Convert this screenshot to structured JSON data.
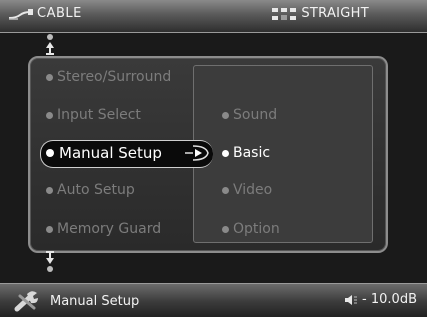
{
  "header": {
    "source": "CABLE",
    "mode": "STRAIGHT",
    "source_icon": "cable-icon",
    "mode_icon": "surround-mode-icon"
  },
  "menu": {
    "items": [
      {
        "label": "Stereo/Surround"
      },
      {
        "label": "Input Select"
      },
      {
        "label": "Manual Setup"
      },
      {
        "label": "Auto Setup"
      },
      {
        "label": "Memory Guard"
      }
    ],
    "selected_index": 2
  },
  "submenu": {
    "items": [
      {
        "label": "Sound"
      },
      {
        "label": "Basic"
      },
      {
        "label": "Video"
      },
      {
        "label": "Option"
      }
    ],
    "highlighted_index": 1
  },
  "footer": {
    "current_menu": "Manual Setup",
    "volume": "- 10.0dB",
    "settings_icon": "wrench-icon",
    "volume_icon": "speaker-icon"
  },
  "colors": {
    "selected": "#ffffff",
    "inactive": "#7c7c7c"
  }
}
